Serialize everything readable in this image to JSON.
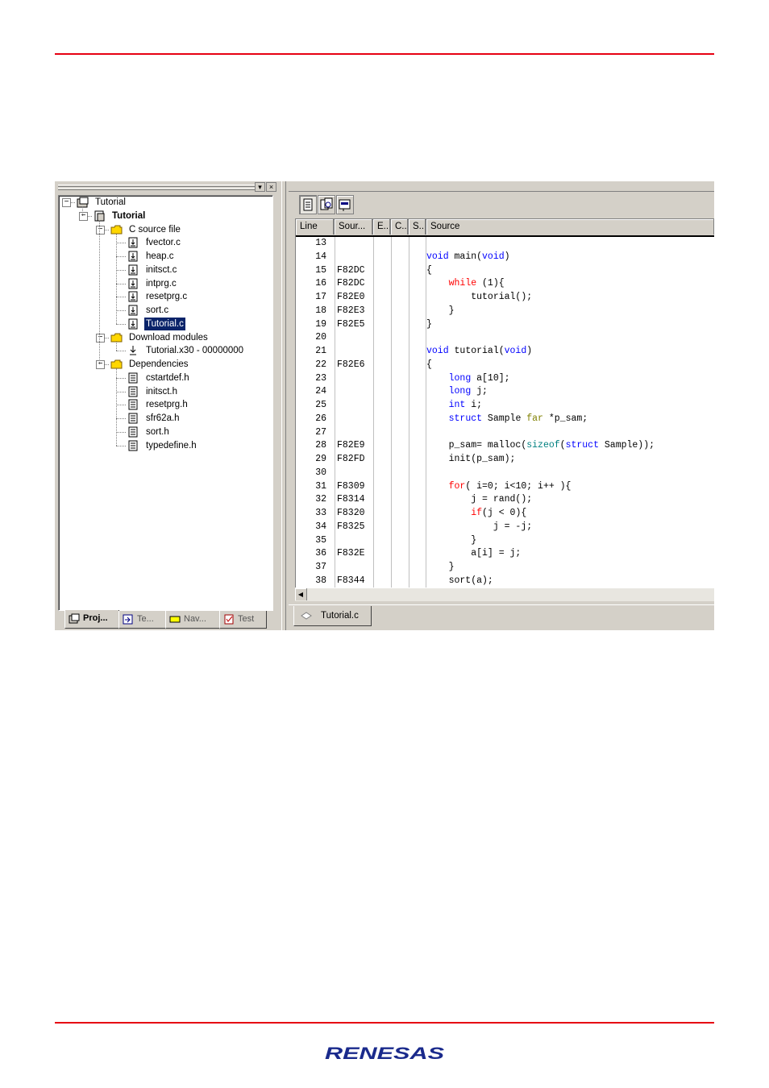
{
  "brand": {
    "logo_text": "RENESAS",
    "rule_color": "#e60012"
  },
  "project_tree": {
    "nodes": [
      {
        "label": "Tutorial",
        "icon": "workspace-icon"
      },
      {
        "label": "Tutorial",
        "icon": "project-icon"
      },
      {
        "label": "C source file",
        "icon": "folder-icon"
      },
      {
        "label": "fvector.c",
        "icon": "source-file-icon"
      },
      {
        "label": "heap.c",
        "icon": "source-file-icon"
      },
      {
        "label": "initsct.c",
        "icon": "source-file-icon"
      },
      {
        "label": "intprg.c",
        "icon": "source-file-icon"
      },
      {
        "label": "resetprg.c",
        "icon": "source-file-icon"
      },
      {
        "label": "sort.c",
        "icon": "source-file-icon"
      },
      {
        "label": "Tutorial.c",
        "icon": "source-file-icon"
      },
      {
        "label": "Download modules",
        "icon": "folder-icon"
      },
      {
        "label": "Tutorial.x30 - 00000000",
        "icon": "download-module-icon"
      },
      {
        "label": "Dependencies",
        "icon": "folder-icon"
      },
      {
        "label": "cstartdef.h",
        "icon": "header-file-icon"
      },
      {
        "label": "initsct.h",
        "icon": "header-file-icon"
      },
      {
        "label": "resetprg.h",
        "icon": "header-file-icon"
      },
      {
        "label": "sfr62a.h",
        "icon": "header-file-icon"
      },
      {
        "label": "sort.h",
        "icon": "header-file-icon"
      },
      {
        "label": "typedefine.h",
        "icon": "header-file-icon"
      }
    ],
    "selected": "Tutorial.c"
  },
  "left_tabs": [
    {
      "label": "Proj...",
      "icon": "projects-tab-icon"
    },
    {
      "label": "Te...",
      "icon": "templates-tab-icon"
    },
    {
      "label": "Nav...",
      "icon": "navigation-tab-icon"
    },
    {
      "label": "Test",
      "icon": "test-tab-icon"
    }
  ],
  "editor": {
    "columns": [
      "Line",
      "Sour...",
      "E..",
      "C..",
      "S..",
      "Source"
    ],
    "rows": [
      {
        "line": "13",
        "addr": "",
        "code": ""
      },
      {
        "line": "14",
        "addr": "",
        "code": "void main(void)"
      },
      {
        "line": "15",
        "addr": "F82DC",
        "code": "{"
      },
      {
        "line": "16",
        "addr": "F82DC",
        "code": "    while (1){"
      },
      {
        "line": "17",
        "addr": "F82E0",
        "code": "        tutorial();"
      },
      {
        "line": "18",
        "addr": "F82E3",
        "code": "    }"
      },
      {
        "line": "19",
        "addr": "F82E5",
        "code": "}"
      },
      {
        "line": "20",
        "addr": "",
        "code": ""
      },
      {
        "line": "21",
        "addr": "",
        "code": "void tutorial(void)"
      },
      {
        "line": "22",
        "addr": "F82E6",
        "code": "{"
      },
      {
        "line": "23",
        "addr": "",
        "code": "    long a[10];"
      },
      {
        "line": "24",
        "addr": "",
        "code": "    long j;"
      },
      {
        "line": "25",
        "addr": "",
        "code": "    int i;"
      },
      {
        "line": "26",
        "addr": "",
        "code": "    struct Sample far *p_sam;"
      },
      {
        "line": "27",
        "addr": "",
        "code": ""
      },
      {
        "line": "28",
        "addr": "F82E9",
        "code": "    p_sam= malloc(sizeof(struct Sample));"
      },
      {
        "line": "29",
        "addr": "F82FD",
        "code": "    init(p_sam);"
      },
      {
        "line": "30",
        "addr": "",
        "code": ""
      },
      {
        "line": "31",
        "addr": "F8309",
        "code": "    for( i=0; i<10; i++ ){"
      },
      {
        "line": "32",
        "addr": "F8314",
        "code": "        j = rand();"
      },
      {
        "line": "33",
        "addr": "F8320",
        "code": "        if(j < 0){"
      },
      {
        "line": "34",
        "addr": "F8325",
        "code": "            j = -j;"
      },
      {
        "line": "35",
        "addr": "",
        "code": "        }"
      },
      {
        "line": "36",
        "addr": "F832E",
        "code": "        a[i] = j;"
      },
      {
        "line": "37",
        "addr": "",
        "code": "    }"
      },
      {
        "line": "38",
        "addr": "F8344",
        "code": "    sort(a);"
      }
    ],
    "keywords": {
      "blue": [
        "void",
        "long",
        "int",
        "struct"
      ],
      "red": [
        "while",
        "for",
        "if"
      ],
      "teal": [
        "sizeof"
      ],
      "olive": [
        "far"
      ]
    }
  },
  "editor_tab": {
    "label": "Tutorial.c"
  }
}
